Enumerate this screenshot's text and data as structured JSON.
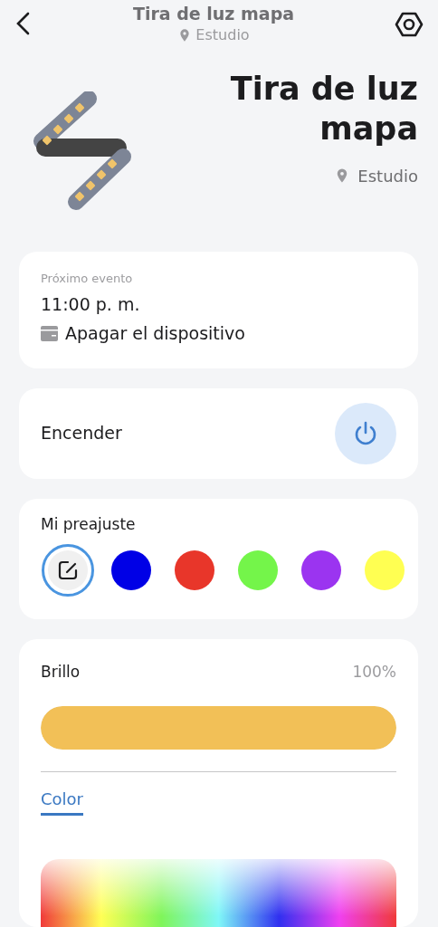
{
  "header": {
    "title": "Tira de luz mapa",
    "location": "Estudio"
  },
  "device": {
    "name": "Tira de luz mapa",
    "location": "Estudio"
  },
  "next_event": {
    "label": "Próximo evento",
    "time": "11:00 p. m.",
    "action": "Apagar el dispositivo"
  },
  "power": {
    "label": "Encender",
    "on": false
  },
  "presets": {
    "title": "Mi preajuste",
    "items": [
      {
        "kind": "edit",
        "selected": true
      },
      {
        "kind": "color",
        "color": "#0000e6",
        "selected": false
      },
      {
        "kind": "color",
        "color": "#e8362a",
        "selected": false
      },
      {
        "kind": "color",
        "color": "#74f54a",
        "selected": false
      },
      {
        "kind": "color",
        "color": "#9b34f0",
        "selected": false
      },
      {
        "kind": "color",
        "color": "#ffff52",
        "selected": false
      }
    ]
  },
  "brightness": {
    "label": "Brillo",
    "reading": "100%",
    "level": 1
  },
  "tabs": [
    {
      "label": "Color",
      "selected": true
    }
  ]
}
